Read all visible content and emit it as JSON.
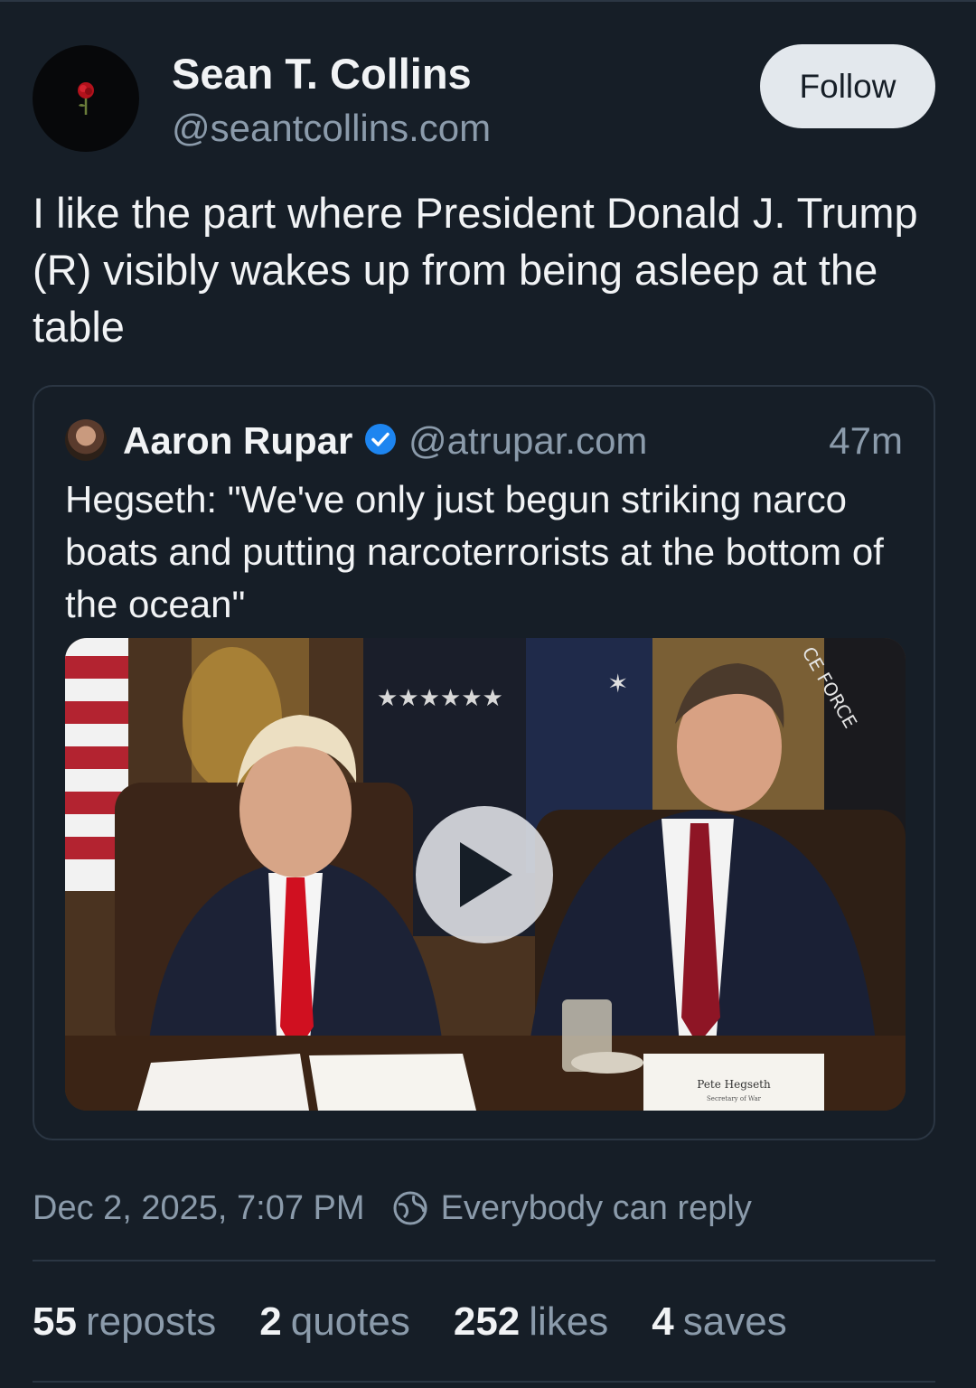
{
  "colors": {
    "background": "#161e27",
    "text": "#f1f3f5",
    "muted": "#8b9bab",
    "border": "#2b3643",
    "follow_button_bg": "#e3e8ed",
    "verified": "#1d85f0"
  },
  "author": {
    "name": "Sean T. Collins",
    "handle": "@seantcollins.com",
    "avatar_icon": "rose-icon"
  },
  "follow_label": "Follow",
  "post": {
    "text": "I like the part where President Donald J. Trump (R) visibly wakes up from being asleep at the table",
    "date": "Dec 2, 2025, 7:07 PM",
    "reply_setting": "Everybody can reply"
  },
  "quote": {
    "name": "Aaron Rupar",
    "verified": true,
    "handle": "@atrupar.com",
    "time": "47m",
    "text": "Hegseth: \"We've only just begun striking narco boats and putting narcoterrorists at the bottom of the ocean\"",
    "video": {
      "nameplate_name": "Pete Hegseth",
      "nameplate_title": "Secretary of War",
      "banner_text": "CE FORCE",
      "play_icon": "play-icon"
    }
  },
  "stats": [
    {
      "count": "55",
      "label": "reposts"
    },
    {
      "count": "2",
      "label": "quotes"
    },
    {
      "count": "252",
      "label": "likes"
    },
    {
      "count": "4",
      "label": "saves"
    }
  ]
}
